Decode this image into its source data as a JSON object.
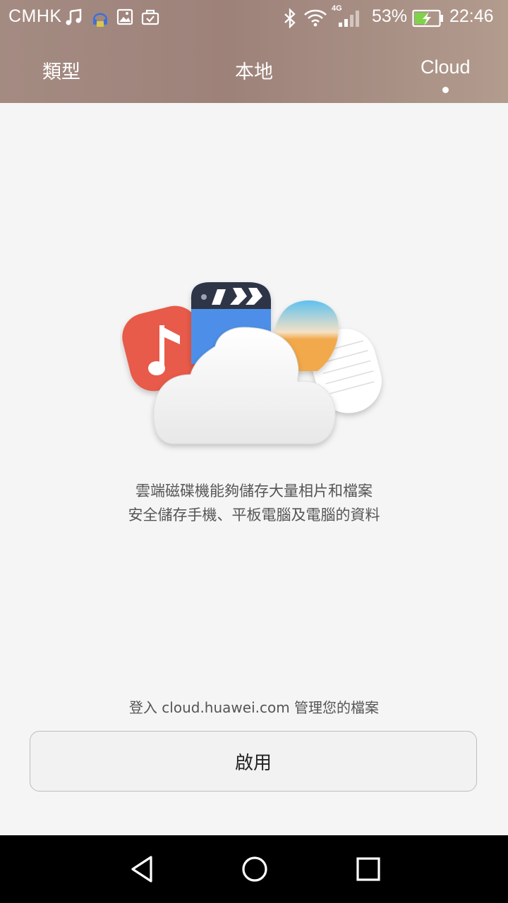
{
  "status_bar": {
    "carrier": "CMHK",
    "network_type": "4G",
    "battery_percent": "53%",
    "time": "22:46",
    "icons": [
      "music-note-icon",
      "headset-icon",
      "image-icon",
      "briefcase-icon",
      "bluetooth-icon",
      "wifi-icon",
      "signal-icon",
      "battery-charging-icon"
    ]
  },
  "tabs": [
    {
      "label": "類型",
      "selected": false
    },
    {
      "label": "本地",
      "selected": false
    },
    {
      "label": "Cloud",
      "selected": true
    }
  ],
  "main": {
    "description_line1": "雲端磁碟機能夠儲存大量相片和檔案",
    "description_line2": "安全儲存手機、平板電腦及電腦的資料",
    "login_hint": "登入 cloud.huawei.com 管理您的檔案",
    "enable_button": "啟用"
  },
  "nav_bar": {
    "icons": [
      "back-icon",
      "home-icon",
      "recents-icon"
    ]
  },
  "colors": {
    "header_gradient": [
      "#a48b82",
      "#b29c8e"
    ],
    "music_tile": "#e85a48",
    "video_tile": "#4d8fe8",
    "photo_tile": "#f2a94c",
    "background": "#f5f5f5"
  }
}
